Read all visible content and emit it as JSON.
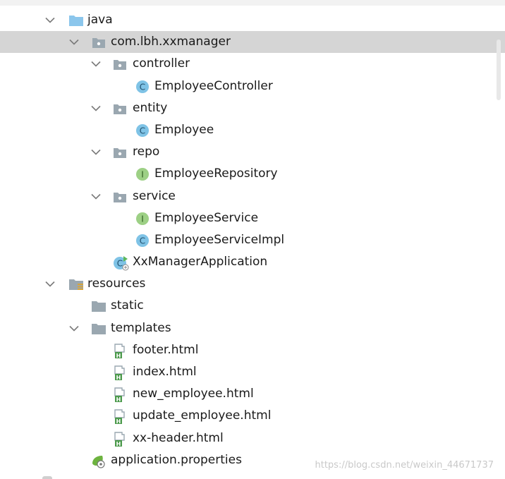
{
  "tree": [
    {
      "label": "java",
      "icon": "source-folder-icon",
      "depth": 0,
      "expanded": true
    },
    {
      "label": "com.lbh.xxmanager",
      "icon": "package-icon",
      "depth": 1,
      "expanded": true,
      "selected": true
    },
    {
      "label": "controller",
      "icon": "package-icon",
      "depth": 2,
      "expanded": true
    },
    {
      "label": "EmployeeController",
      "icon": "class-icon",
      "depth": 3
    },
    {
      "label": "entity",
      "icon": "package-icon",
      "depth": 2,
      "expanded": true
    },
    {
      "label": "Employee",
      "icon": "class-icon",
      "depth": 3
    },
    {
      "label": "repo",
      "icon": "package-icon",
      "depth": 2,
      "expanded": true
    },
    {
      "label": "EmployeeRepository",
      "icon": "interface-icon",
      "depth": 3
    },
    {
      "label": "service",
      "icon": "package-icon",
      "depth": 2,
      "expanded": true
    },
    {
      "label": "EmployeeService",
      "icon": "interface-icon",
      "depth": 3
    },
    {
      "label": "EmployeeServiceImpl",
      "icon": "class-icon",
      "depth": 3
    },
    {
      "label": "XxManagerApplication",
      "icon": "spring-boot-class-icon",
      "depth": 2
    },
    {
      "label": "resources",
      "icon": "resources-folder-icon",
      "depth": 0,
      "expanded": true
    },
    {
      "label": "static",
      "icon": "folder-icon",
      "depth": 1
    },
    {
      "label": "templates",
      "icon": "folder-icon",
      "depth": 1,
      "expanded": true
    },
    {
      "label": "footer.html",
      "icon": "html-file-icon",
      "depth": 2
    },
    {
      "label": "index.html",
      "icon": "html-file-icon",
      "depth": 2
    },
    {
      "label": "new_employee.html",
      "icon": "html-file-icon",
      "depth": 2
    },
    {
      "label": "update_employee.html",
      "icon": "html-file-icon",
      "depth": 2
    },
    {
      "label": "xx-header.html",
      "icon": "html-file-icon",
      "depth": 2
    },
    {
      "label": "application.properties",
      "icon": "spring-properties-icon",
      "depth": 1
    }
  ],
  "watermark": "https://blog.csdn.net/weixin_44671737",
  "colors": {
    "selection": "#d5d5d5",
    "folder": "#9aa7b0",
    "source_folder": "#8bc6ec",
    "class": "#7fc3e6",
    "interface": "#9dd085",
    "html_green": "#4c9a4c"
  }
}
